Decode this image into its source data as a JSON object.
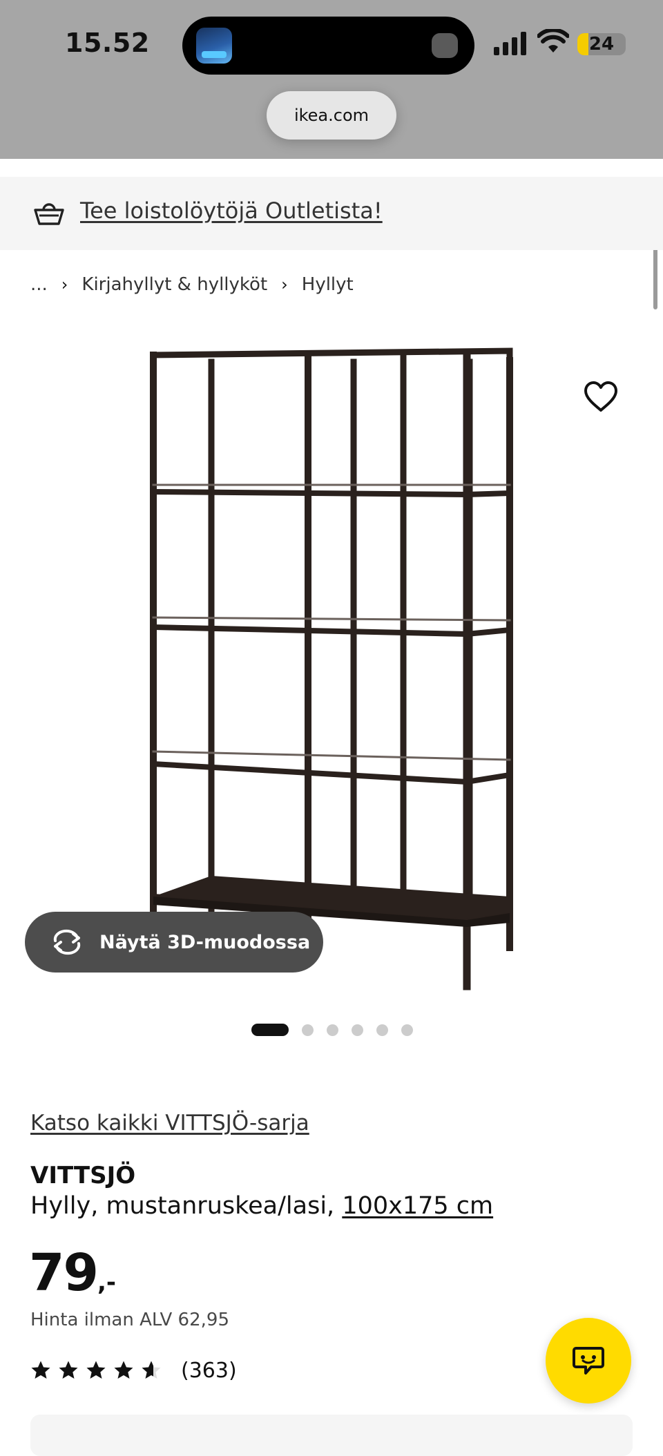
{
  "status_bar": {
    "time": "15.52",
    "battery": "24"
  },
  "browser": {
    "url": "ikea.com"
  },
  "banner": {
    "link_text": "Tee loistolöytöjä Outletista!",
    "icon": "basket-icon"
  },
  "breadcrumb": {
    "ellipsis": "...",
    "items": [
      "Kirjahyllyt & hyllyköt",
      "Hyllyt"
    ]
  },
  "gallery": {
    "view3d_label": "Näytä 3D-muodossa",
    "view3d_icon": "rotate-3d-icon",
    "favorite_icon": "heart-icon",
    "image_count": 6,
    "active_index": 0
  },
  "product": {
    "series_link": "Katso kaikki VITTSJÖ-sarja",
    "name": "VITTSJÖ",
    "description": "Hylly, mustanruskea/lasi,",
    "size": "100x175 cm",
    "price_integer": "79",
    "price_suffix": ",-",
    "price_vat": "Hinta ilman ALV 62,95",
    "rating": 4.6,
    "rating_max": 5,
    "review_count": "(363)"
  },
  "chat": {
    "icon": "chat-bubble-icon"
  },
  "colors": {
    "accent_yellow": "#ffdb00",
    "dark_pill": "#4d4d4d",
    "banner_bg": "#f5f5f5",
    "shelf_frame": "#2a211d"
  }
}
